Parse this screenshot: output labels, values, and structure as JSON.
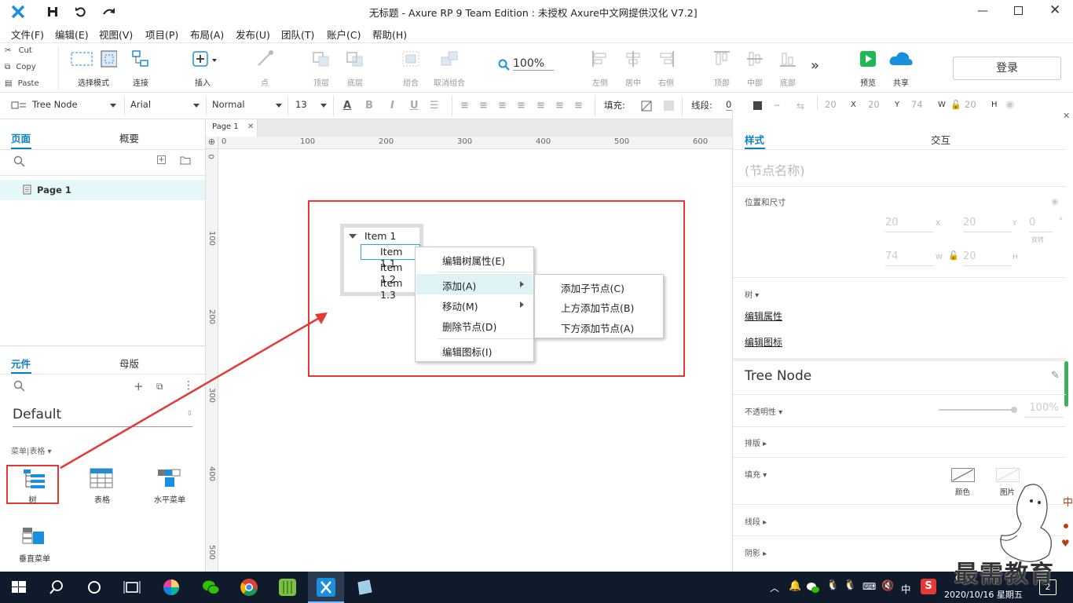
{
  "titlebar": {
    "title": "无标题 - Axure RP 9 Team Edition : 未授权    Axure中文网提供汉化 V7.2]"
  },
  "menu": [
    "文件(F)",
    "编辑(E)",
    "视图(V)",
    "项目(P)",
    "布局(A)",
    "发布(U)",
    "团队(T)",
    "账户(C)",
    "帮助(H)"
  ],
  "clipboard": {
    "cut": "Cut",
    "copy": "Copy",
    "paste": "Paste"
  },
  "toolbar": {
    "select_mode": "选择模式",
    "connect": "连接",
    "insert": "插入",
    "point": "点",
    "top_layer": "顶层",
    "bottom_layer": "底层",
    "group": "组合",
    "ungroup": "取消组合",
    "zoom": "100%",
    "align_left": "左侧",
    "align_center": "居中",
    "align_right": "右侧",
    "align_top": "顶部",
    "align_middle": "中部",
    "align_bottom": "底部",
    "more": "»",
    "preview": "预览",
    "share": "共享",
    "login": "登录"
  },
  "format": {
    "style": "Tree Node",
    "font": "Arial",
    "weight": "Normal",
    "size": "13",
    "fill_label": "填充:",
    "line_label": "线段:",
    "line_value": "0",
    "x": "20",
    "x_label": "X",
    "y": "20",
    "y_label": "Y",
    "w": "74",
    "w_label": "W",
    "h": "20",
    "h_label": "H"
  },
  "pages_panel": {
    "tab_pages": "页面",
    "tab_outline": "概要",
    "page1": "Page 1"
  },
  "widgets_panel": {
    "tab_widgets": "元件",
    "tab_masters": "母版",
    "library": "Default",
    "category": "菜单|表格 ▾",
    "items": [
      "树",
      "表格",
      "水平菜单",
      "垂直菜单"
    ]
  },
  "canvas": {
    "tab": "Page 1",
    "ruler_h": [
      "0",
      "100",
      "200",
      "300",
      "400",
      "500",
      "600"
    ],
    "ruler_v": [
      "0",
      "100",
      "200",
      "300",
      "400",
      "500"
    ],
    "tree": {
      "root": "Item 1",
      "children": [
        "Item 1.1",
        "Item 1.2",
        "Item 1.3"
      ]
    },
    "context_menu": [
      "编辑树属性(E)",
      "添加(A)",
      "移动(M)",
      "删除节点(D)",
      "编辑图标(I)"
    ],
    "submenu": [
      "添加子节点(C)",
      "上方添加节点(B)",
      "下方添加节点(A)"
    ]
  },
  "inspector": {
    "tab_style": "样式",
    "tab_interact": "交互",
    "node_name_placeholder": "(节点名称)",
    "pos_size": "位置和尺寸",
    "x": "20",
    "x_label": "X",
    "y": "20",
    "y_label": "Y",
    "rot": "0",
    "rot_unit": "°",
    "rot_label": "旋转",
    "w": "74",
    "w_label": "W",
    "h": "20",
    "h_label": "H",
    "tree_label": "树 ▾",
    "edit_props": "编辑属性",
    "edit_icon": "编辑图标",
    "style_name": "Tree Node",
    "opacity": "不透明性 ▾",
    "opacity_value": "100%",
    "layout": "排版 ▸",
    "fill": "填充 ▾",
    "fill_color": "颜色",
    "fill_image": "图片",
    "line": "线段 ▸",
    "shadow": "阴影 ▸"
  },
  "taskbar": {
    "time": "9:",
    "date": "2020/10/16 星期五",
    "ime": "中",
    "notify_count": "2",
    "watermark": "最需教育"
  },
  "colors": {
    "accent": "#0a7fc4",
    "highlight": "#e53935",
    "taskbar": "#0f1a2b",
    "selected_row": "#e6f7f9"
  }
}
